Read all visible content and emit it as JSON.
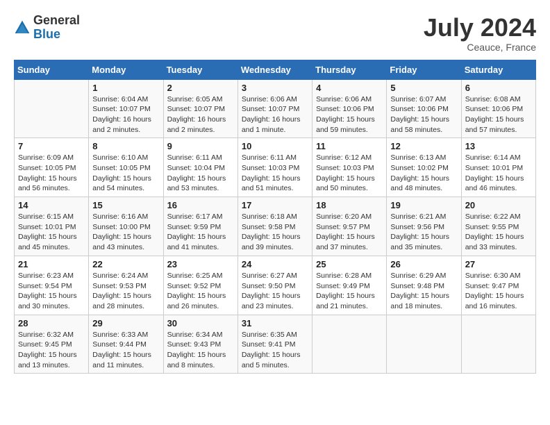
{
  "header": {
    "logo_general": "General",
    "logo_blue": "Blue",
    "month_year": "July 2024",
    "location": "Ceauce, France"
  },
  "weekdays": [
    "Sunday",
    "Monday",
    "Tuesday",
    "Wednesday",
    "Thursday",
    "Friday",
    "Saturday"
  ],
  "weeks": [
    [
      {
        "day": "",
        "sunrise": "",
        "sunset": "",
        "daylight": ""
      },
      {
        "day": "1",
        "sunrise": "Sunrise: 6:04 AM",
        "sunset": "Sunset: 10:07 PM",
        "daylight": "Daylight: 16 hours and 2 minutes."
      },
      {
        "day": "2",
        "sunrise": "Sunrise: 6:05 AM",
        "sunset": "Sunset: 10:07 PM",
        "daylight": "Daylight: 16 hours and 2 minutes."
      },
      {
        "day": "3",
        "sunrise": "Sunrise: 6:06 AM",
        "sunset": "Sunset: 10:07 PM",
        "daylight": "Daylight: 16 hours and 1 minute."
      },
      {
        "day": "4",
        "sunrise": "Sunrise: 6:06 AM",
        "sunset": "Sunset: 10:06 PM",
        "daylight": "Daylight: 15 hours and 59 minutes."
      },
      {
        "day": "5",
        "sunrise": "Sunrise: 6:07 AM",
        "sunset": "Sunset: 10:06 PM",
        "daylight": "Daylight: 15 hours and 58 minutes."
      },
      {
        "day": "6",
        "sunrise": "Sunrise: 6:08 AM",
        "sunset": "Sunset: 10:06 PM",
        "daylight": "Daylight: 15 hours and 57 minutes."
      }
    ],
    [
      {
        "day": "7",
        "sunrise": "Sunrise: 6:09 AM",
        "sunset": "Sunset: 10:05 PM",
        "daylight": "Daylight: 15 hours and 56 minutes."
      },
      {
        "day": "8",
        "sunrise": "Sunrise: 6:10 AM",
        "sunset": "Sunset: 10:05 PM",
        "daylight": "Daylight: 15 hours and 54 minutes."
      },
      {
        "day": "9",
        "sunrise": "Sunrise: 6:11 AM",
        "sunset": "Sunset: 10:04 PM",
        "daylight": "Daylight: 15 hours and 53 minutes."
      },
      {
        "day": "10",
        "sunrise": "Sunrise: 6:11 AM",
        "sunset": "Sunset: 10:03 PM",
        "daylight": "Daylight: 15 hours and 51 minutes."
      },
      {
        "day": "11",
        "sunrise": "Sunrise: 6:12 AM",
        "sunset": "Sunset: 10:03 PM",
        "daylight": "Daylight: 15 hours and 50 minutes."
      },
      {
        "day": "12",
        "sunrise": "Sunrise: 6:13 AM",
        "sunset": "Sunset: 10:02 PM",
        "daylight": "Daylight: 15 hours and 48 minutes."
      },
      {
        "day": "13",
        "sunrise": "Sunrise: 6:14 AM",
        "sunset": "Sunset: 10:01 PM",
        "daylight": "Daylight: 15 hours and 46 minutes."
      }
    ],
    [
      {
        "day": "14",
        "sunrise": "Sunrise: 6:15 AM",
        "sunset": "Sunset: 10:01 PM",
        "daylight": "Daylight: 15 hours and 45 minutes."
      },
      {
        "day": "15",
        "sunrise": "Sunrise: 6:16 AM",
        "sunset": "Sunset: 10:00 PM",
        "daylight": "Daylight: 15 hours and 43 minutes."
      },
      {
        "day": "16",
        "sunrise": "Sunrise: 6:17 AM",
        "sunset": "Sunset: 9:59 PM",
        "daylight": "Daylight: 15 hours and 41 minutes."
      },
      {
        "day": "17",
        "sunrise": "Sunrise: 6:18 AM",
        "sunset": "Sunset: 9:58 PM",
        "daylight": "Daylight: 15 hours and 39 minutes."
      },
      {
        "day": "18",
        "sunrise": "Sunrise: 6:20 AM",
        "sunset": "Sunset: 9:57 PM",
        "daylight": "Daylight: 15 hours and 37 minutes."
      },
      {
        "day": "19",
        "sunrise": "Sunrise: 6:21 AM",
        "sunset": "Sunset: 9:56 PM",
        "daylight": "Daylight: 15 hours and 35 minutes."
      },
      {
        "day": "20",
        "sunrise": "Sunrise: 6:22 AM",
        "sunset": "Sunset: 9:55 PM",
        "daylight": "Daylight: 15 hours and 33 minutes."
      }
    ],
    [
      {
        "day": "21",
        "sunrise": "Sunrise: 6:23 AM",
        "sunset": "Sunset: 9:54 PM",
        "daylight": "Daylight: 15 hours and 30 minutes."
      },
      {
        "day": "22",
        "sunrise": "Sunrise: 6:24 AM",
        "sunset": "Sunset: 9:53 PM",
        "daylight": "Daylight: 15 hours and 28 minutes."
      },
      {
        "day": "23",
        "sunrise": "Sunrise: 6:25 AM",
        "sunset": "Sunset: 9:52 PM",
        "daylight": "Daylight: 15 hours and 26 minutes."
      },
      {
        "day": "24",
        "sunrise": "Sunrise: 6:27 AM",
        "sunset": "Sunset: 9:50 PM",
        "daylight": "Daylight: 15 hours and 23 minutes."
      },
      {
        "day": "25",
        "sunrise": "Sunrise: 6:28 AM",
        "sunset": "Sunset: 9:49 PM",
        "daylight": "Daylight: 15 hours and 21 minutes."
      },
      {
        "day": "26",
        "sunrise": "Sunrise: 6:29 AM",
        "sunset": "Sunset: 9:48 PM",
        "daylight": "Daylight: 15 hours and 18 minutes."
      },
      {
        "day": "27",
        "sunrise": "Sunrise: 6:30 AM",
        "sunset": "Sunset: 9:47 PM",
        "daylight": "Daylight: 15 hours and 16 minutes."
      }
    ],
    [
      {
        "day": "28",
        "sunrise": "Sunrise: 6:32 AM",
        "sunset": "Sunset: 9:45 PM",
        "daylight": "Daylight: 15 hours and 13 minutes."
      },
      {
        "day": "29",
        "sunrise": "Sunrise: 6:33 AM",
        "sunset": "Sunset: 9:44 PM",
        "daylight": "Daylight: 15 hours and 11 minutes."
      },
      {
        "day": "30",
        "sunrise": "Sunrise: 6:34 AM",
        "sunset": "Sunset: 9:43 PM",
        "daylight": "Daylight: 15 hours and 8 minutes."
      },
      {
        "day": "31",
        "sunrise": "Sunrise: 6:35 AM",
        "sunset": "Sunset: 9:41 PM",
        "daylight": "Daylight: 15 hours and 5 minutes."
      },
      {
        "day": "",
        "sunrise": "",
        "sunset": "",
        "daylight": ""
      },
      {
        "day": "",
        "sunrise": "",
        "sunset": "",
        "daylight": ""
      },
      {
        "day": "",
        "sunrise": "",
        "sunset": "",
        "daylight": ""
      }
    ]
  ]
}
